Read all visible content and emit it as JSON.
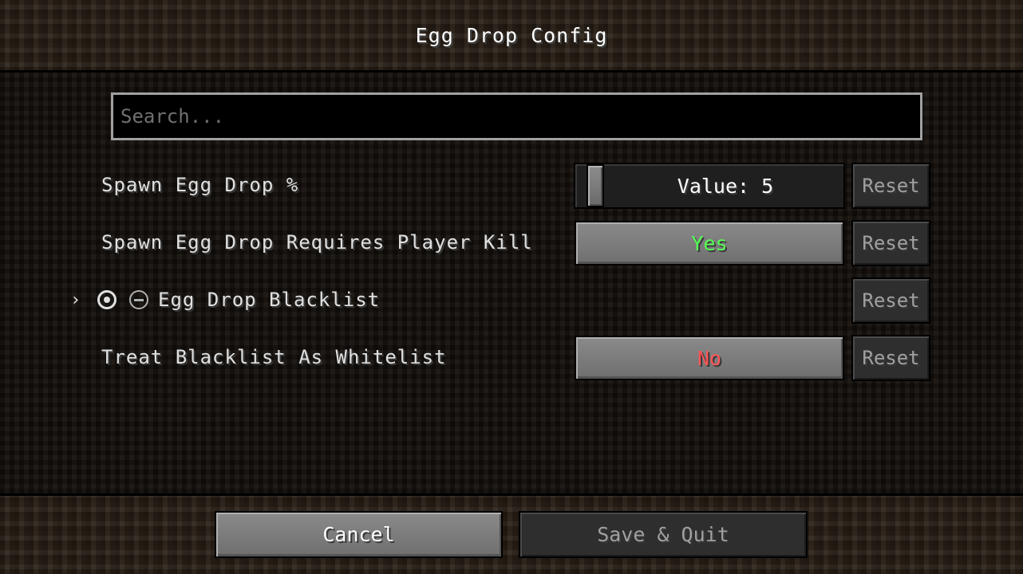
{
  "title": "Egg Drop Config",
  "search": {
    "placeholder": "Search..."
  },
  "entries": [
    {
      "label": "Spawn Egg Drop %",
      "control": "slider",
      "value_text": "Value: 5",
      "value": 5,
      "reset_label": "Reset"
    },
    {
      "label": "Spawn Egg Drop Requires Player Kill",
      "control": "toggle",
      "value_text": "Yes",
      "value_color": "#55ff55",
      "reset_label": "Reset"
    },
    {
      "label": "Egg Drop Blacklist",
      "control": "list",
      "expand_icon": "chevron-right-icon",
      "add_icon": "add-circle-icon",
      "remove_icon": "remove-circle-icon",
      "reset_label": "Reset"
    },
    {
      "label": "Treat Blacklist As Whitelist",
      "control": "toggle",
      "value_text": "No",
      "value_color": "#ff5555",
      "reset_label": "Reset"
    }
  ],
  "footer": {
    "cancel_label": "Cancel",
    "save_label": "Save & Quit"
  }
}
